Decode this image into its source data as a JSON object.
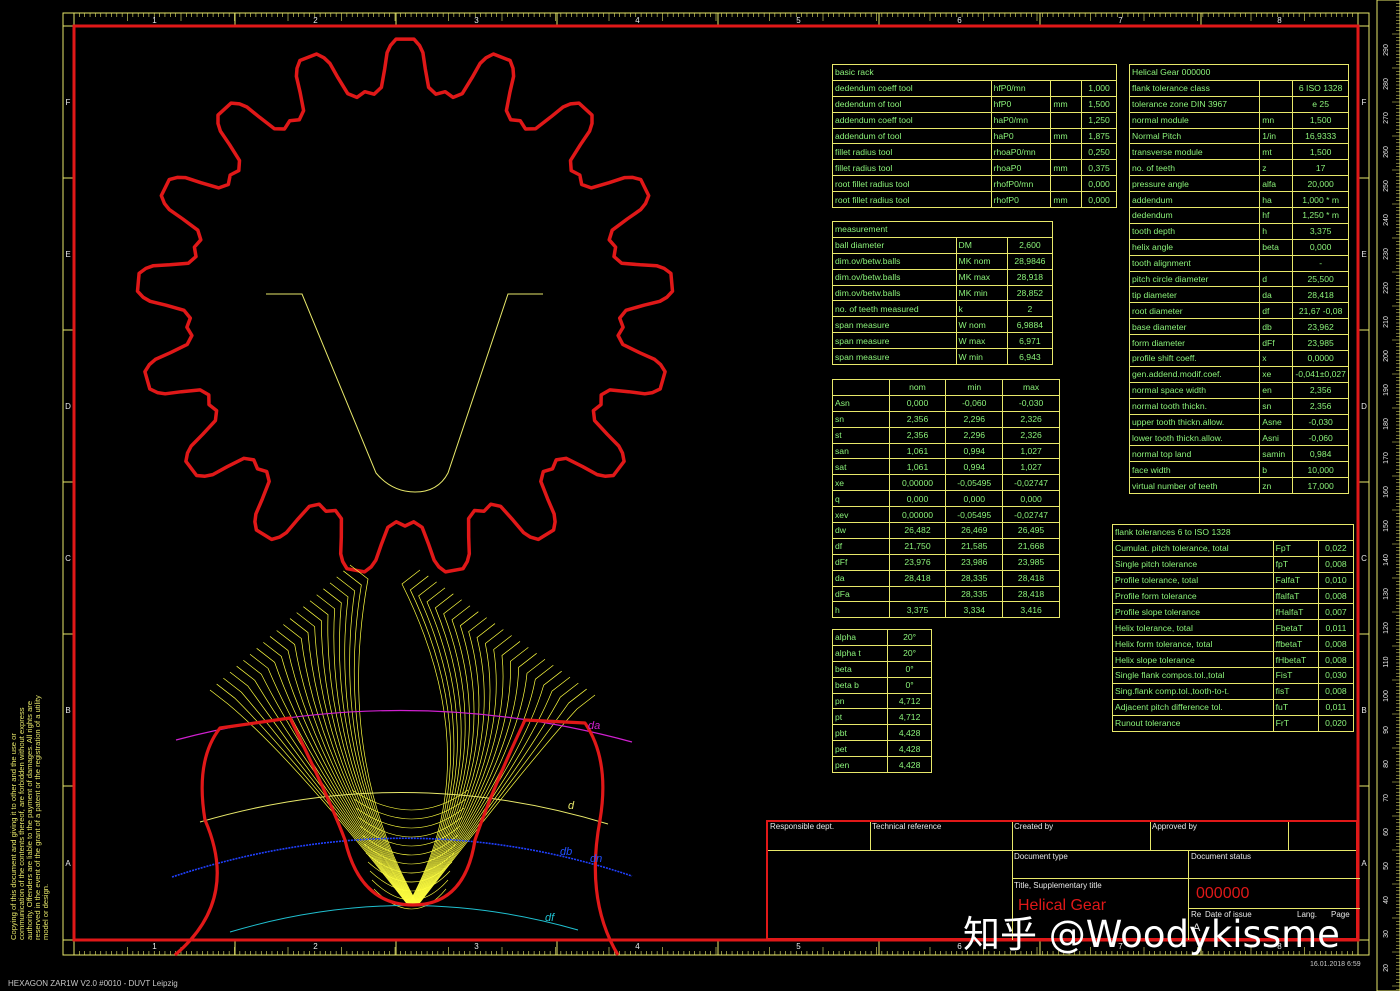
{
  "colors": {
    "frame": "#e01818",
    "grid": "#e8e86a",
    "text": "#8cf47a",
    "gear": "#e01818",
    "yellow": "#ffff40",
    "magenta": "#d020d0",
    "blue": "#2040ff",
    "cyan": "#20c0d0"
  },
  "ruler": {
    "top_numbers": [
      "1",
      "2",
      "3",
      "4",
      "5",
      "6",
      "7",
      "8"
    ],
    "side_letters": [
      "F",
      "E",
      "D",
      "C",
      "B",
      "A"
    ],
    "side_numbers": [
      "290",
      "280",
      "270",
      "260",
      "250",
      "240",
      "230",
      "220",
      "210",
      "200",
      "190",
      "180",
      "170",
      "160",
      "150",
      "140",
      "130",
      "120",
      "110",
      "100",
      "90",
      "80",
      "70",
      "60",
      "50",
      "40",
      "30",
      "20"
    ]
  },
  "basic_rack": {
    "title": "basic rack",
    "rows": [
      [
        "dedendum coeff tool",
        "hfP0/mn",
        "",
        "1,000"
      ],
      [
        "dedendum of tool",
        "hfP0",
        "mm",
        "1,500"
      ],
      [
        "addendum coeff tool",
        "haP0/mn",
        "",
        "1,250"
      ],
      [
        "addendum of tool",
        "haP0",
        "mm",
        "1,875"
      ],
      [
        "fillet radius  tool",
        "rhoaP0/mn",
        "",
        "0,250"
      ],
      [
        "fillet radius  tool",
        "rhoaP0",
        "mm",
        "0,375"
      ],
      [
        "root fillet radius  tool",
        "rhofP0/mn",
        "",
        "0,000"
      ],
      [
        "root fillet radius  tool",
        "rhofP0",
        "mm",
        "0,000"
      ]
    ]
  },
  "measurement": {
    "title": "measurement",
    "rows": [
      [
        "ball diameter",
        "DM",
        "2,600"
      ],
      [
        "dim.ov/betw.balls",
        "MK nom",
        "28,9846"
      ],
      [
        "dim.ov/betw.balls",
        "MK max",
        "28,918"
      ],
      [
        "dim.ov/betw.balls",
        "MK min",
        "28,852"
      ],
      [
        "no. of teeth measured",
        "k",
        "2"
      ],
      [
        "span measure",
        "W nom",
        "6,9884"
      ],
      [
        "span measure",
        "W max",
        "6,971"
      ],
      [
        "span measure",
        "W min",
        "6,943"
      ]
    ]
  },
  "tolerances_table": {
    "headers": [
      "",
      "nom",
      "min",
      "max"
    ],
    "rows": [
      [
        "Asn",
        "0,000",
        "-0,060",
        "-0,030"
      ],
      [
        "sn",
        "2,356",
        "2,296",
        "2,326"
      ],
      [
        "st",
        "2,356",
        "2,296",
        "2,326"
      ],
      [
        "san",
        "1,061",
        "0,994",
        "1,027"
      ],
      [
        "sat",
        "1,061",
        "0,994",
        "1,027"
      ],
      [
        "xe",
        "0,00000",
        "-0,05495",
        "-0,02747"
      ],
      [
        "q",
        "0,000",
        "0,000",
        "0,000"
      ],
      [
        "xev",
        "0,00000",
        "-0,05495",
        "-0,02747"
      ],
      [
        "dw",
        "26,482",
        "26,469",
        "26,495"
      ],
      [
        "df",
        "21,750",
        "21,585",
        "21,668"
      ],
      [
        "dFf",
        "23,976",
        "23,986",
        "23,985"
      ],
      [
        "da",
        "28,418",
        "28,335",
        "28,418"
      ],
      [
        "dFa",
        "",
        "28,335",
        "28,418"
      ],
      [
        "h",
        "3,375",
        "3,334",
        "3,416"
      ]
    ]
  },
  "angles_table": {
    "rows": [
      [
        "alpha",
        "20°"
      ],
      [
        "alpha t",
        "20°"
      ],
      [
        "beta",
        "0°"
      ],
      [
        "beta b",
        "0°"
      ],
      [
        "pn",
        "4,712"
      ],
      [
        "pt",
        "4,712"
      ],
      [
        "pbt",
        "4,428"
      ],
      [
        "pet",
        "4,428"
      ],
      [
        "pen",
        "4,428"
      ]
    ]
  },
  "helical_gear": {
    "title": "Helical Gear 000000",
    "rows": [
      [
        "flank tolerance class",
        "",
        "6 ISO 1328"
      ],
      [
        "tolerance zone DIN 3967",
        "",
        "e 25"
      ],
      [
        "normal module",
        "mn",
        "1,500"
      ],
      [
        "Normal Pitch",
        "1/in",
        "16,9333"
      ],
      [
        "transverse module",
        "mt",
        "1,500"
      ],
      [
        "no. of teeth",
        "z",
        "17"
      ],
      [
        "pressure angle",
        "alfa",
        "20,000"
      ],
      [
        "addendum",
        "ha",
        "1,000 * m"
      ],
      [
        "dedendum",
        "hf",
        "1,250 * m"
      ],
      [
        "tooth depth",
        "h",
        "3,375"
      ],
      [
        "helix angle",
        "beta",
        "0,000"
      ],
      [
        "tooth alignment",
        "",
        "-"
      ],
      [
        "pitch circle diameter",
        "d",
        "25,500"
      ],
      [
        "tip diameter",
        "da",
        "28,418"
      ],
      [
        "root diameter",
        "df",
        "21,67 -0,08"
      ],
      [
        "base diameter",
        "db",
        "23,962"
      ],
      [
        "form diameter",
        "dFf",
        "23,985"
      ],
      [
        "profile shift coeff.",
        "x",
        "0,0000"
      ],
      [
        "gen.addend.modif.coef.",
        "xe",
        "-0,041±0,027"
      ],
      [
        "normal space width",
        "en",
        "2,356"
      ],
      [
        "normal tooth thickn.",
        "sn",
        "2,356"
      ],
      [
        "upper tooth thickn.allow.",
        "Asne",
        "-0,030"
      ],
      [
        "lower tooth thickn.allow.",
        "Asni",
        "-0,060"
      ],
      [
        "normal top land",
        "samin",
        "0,984"
      ],
      [
        "face width",
        "b",
        "10,000"
      ],
      [
        "virtual number of teeth",
        "zn",
        "17,000"
      ]
    ]
  },
  "flank_tolerances": {
    "title": "flank tolerances 6 to ISO 1328",
    "rows": [
      [
        "Cumulat. pitch tolerance, total",
        "FpT",
        "0,022"
      ],
      [
        "Single pitch tolerance",
        "fpT",
        "0,008"
      ],
      [
        "Profile tolerance, total",
        "FalfaT",
        "0,010"
      ],
      [
        "Profile form tolerance",
        "ffalfaT",
        "0,008"
      ],
      [
        "Profile slope tolerance",
        "fHalfaT",
        "0,007"
      ],
      [
        "Helix tolerance, total",
        "FbetaT",
        "0,011"
      ],
      [
        "Helix form tolerance, total",
        "ffbetaT",
        "0,008"
      ],
      [
        "Helix slope tolerance",
        "fHbetaT",
        "0,008"
      ],
      [
        "Single flank compos.tol.,total",
        "FisT",
        "0,030"
      ],
      [
        "Sing.flank comp.tol.,tooth-to-t.",
        "fisT",
        "0,008"
      ],
      [
        "Adjacent pitch difference tol.",
        "fuT",
        "0,011"
      ],
      [
        "Runout tolerance",
        "FrT",
        "0,020"
      ]
    ]
  },
  "title_block": {
    "responsible_dept": "Responsible dept.",
    "technical_reference": "Technical reference",
    "created_by": "Created by",
    "approved_by": "Approved by",
    "document_type": "Document type",
    "document_status": "Document status",
    "title_label": "Title, Supplementary title",
    "title_value": "Helical Gear",
    "doc_number": "000000",
    "rev_label": "Re",
    "date_label": "Date of issue",
    "lang_label": "Lang.",
    "page_label": "Page",
    "rev_value": "A"
  },
  "diagram_labels": {
    "da": "da",
    "d": "d",
    "db": "db",
    "dn": "dn",
    "df": "df"
  },
  "footer": {
    "program": "HEXAGON ZAR1W V2.0 #0010 - DUVT Leipzig",
    "timestamp": "16.01.2018 6:59"
  },
  "watermark": "知乎 @Woodykissme",
  "copyright": "Copying of this document and giving it to other and the use or communication of the contents thereof, are forbidden without express authority. Offenders are liable to the payment of damages. All rights are reserved in the event of the grant of a patent or the registration of a utility model or design."
}
